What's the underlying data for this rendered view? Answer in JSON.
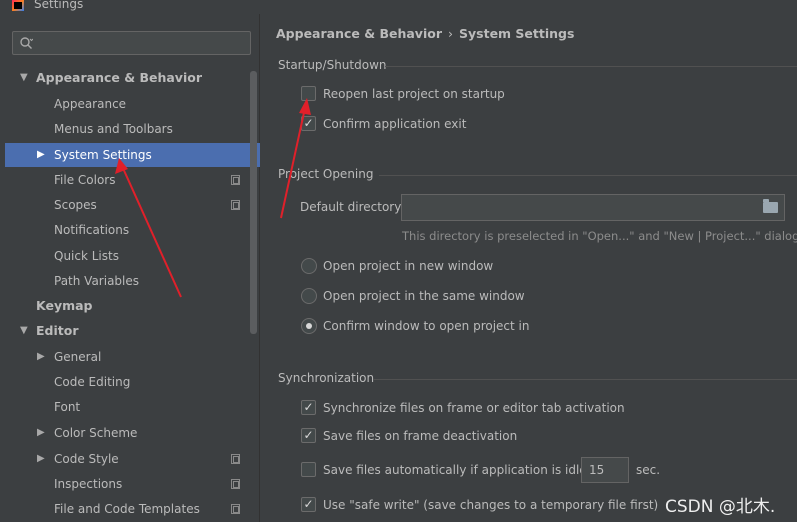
{
  "window": {
    "title": "Settings"
  },
  "search": {
    "placeholder": ""
  },
  "sidebar": {
    "items": [
      {
        "label": "Appearance & Behavior",
        "expanded": true
      },
      {
        "label": "Appearance"
      },
      {
        "label": "Menus and Toolbars"
      },
      {
        "label": "System Settings",
        "selected": true
      },
      {
        "label": "File Colors"
      },
      {
        "label": "Scopes"
      },
      {
        "label": "Notifications"
      },
      {
        "label": "Quick Lists"
      },
      {
        "label": "Path Variables"
      },
      {
        "label": "Keymap"
      },
      {
        "label": "Editor",
        "expanded": true
      },
      {
        "label": "General"
      },
      {
        "label": "Code Editing"
      },
      {
        "label": "Font"
      },
      {
        "label": "Color Scheme"
      },
      {
        "label": "Code Style"
      },
      {
        "label": "Inspections"
      },
      {
        "label": "File and Code Templates"
      }
    ]
  },
  "breadcrumb": {
    "parent": "Appearance & Behavior",
    "separator": "›",
    "current": "System Settings"
  },
  "startup": {
    "title": "Startup/Shutdown",
    "reopen_label": "Reopen last project on startup",
    "reopen_checked": false,
    "confirm_exit_label": "Confirm application exit",
    "confirm_exit_checked": true
  },
  "project_opening": {
    "title": "Project Opening",
    "default_dir_label": "Default directory:",
    "default_dir_value": "",
    "hint": "This directory is preselected in \"Open...\" and \"New | Project...\" dialogs.",
    "radio_new_window": "Open project in new window",
    "radio_same_window": "Open project in the same window",
    "radio_confirm": "Confirm window to open project in",
    "selected": "Confirm window to open project in"
  },
  "sync": {
    "title": "Synchronization",
    "sync_files_label": "Synchronize files on frame or editor tab activation",
    "sync_files_checked": true,
    "save_deactivation_label": "Save files on frame deactivation",
    "save_deactivation_checked": true,
    "save_idle_label": "Save files automatically if application is idle for",
    "save_idle_checked": false,
    "idle_seconds": "15",
    "seconds_label": "sec.",
    "safe_write_label": "Use \"safe write\" (save changes to a temporary file first)",
    "safe_write_checked": true
  },
  "watermark": "CSDN @北木.",
  "colors": {
    "selection": "#4b6eaf",
    "annotation_arrow": "#e0202a",
    "background": "#3c3f41"
  }
}
